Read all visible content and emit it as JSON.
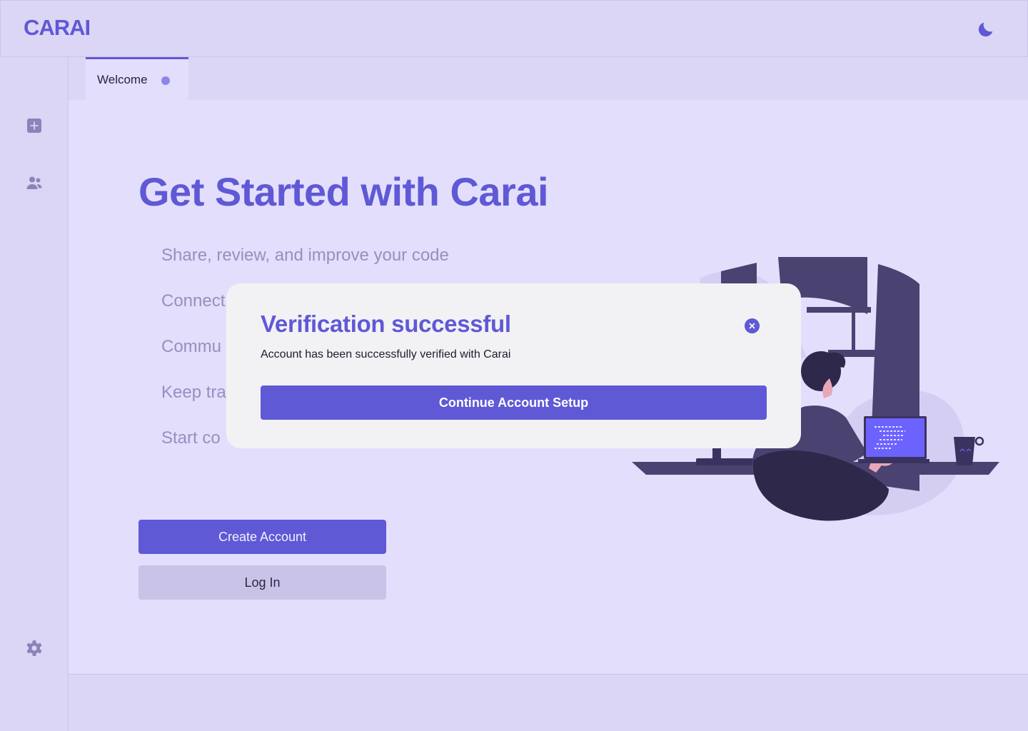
{
  "app": {
    "logo": "CARAI"
  },
  "header": {
    "theme_toggle_icon": "moon-icon"
  },
  "sidebar": {
    "items": [
      {
        "icon": "plus-square-icon"
      },
      {
        "icon": "users-icon"
      },
      {
        "icon": "gear-icon"
      }
    ]
  },
  "tabs": [
    {
      "label": "Welcome",
      "unsaved_indicator": true
    }
  ],
  "hero": {
    "title": "Get Started with Carai",
    "features": [
      "Share, review, and improve your code",
      "Connect",
      "Commu",
      "Keep tra",
      "Start co"
    ],
    "create_account_label": "Create Account",
    "login_label": "Log In"
  },
  "modal": {
    "title": "Verification successful",
    "message": "Account has been successfully verified with Carai",
    "button_label": "Continue Account Setup",
    "close_icon": "close-icon"
  },
  "colors": {
    "accent": "#5f59d6",
    "background": "#e3defc",
    "panel": "#dcd6f6",
    "modal": "#f2f2f4",
    "feature_text": "#9790bd"
  }
}
